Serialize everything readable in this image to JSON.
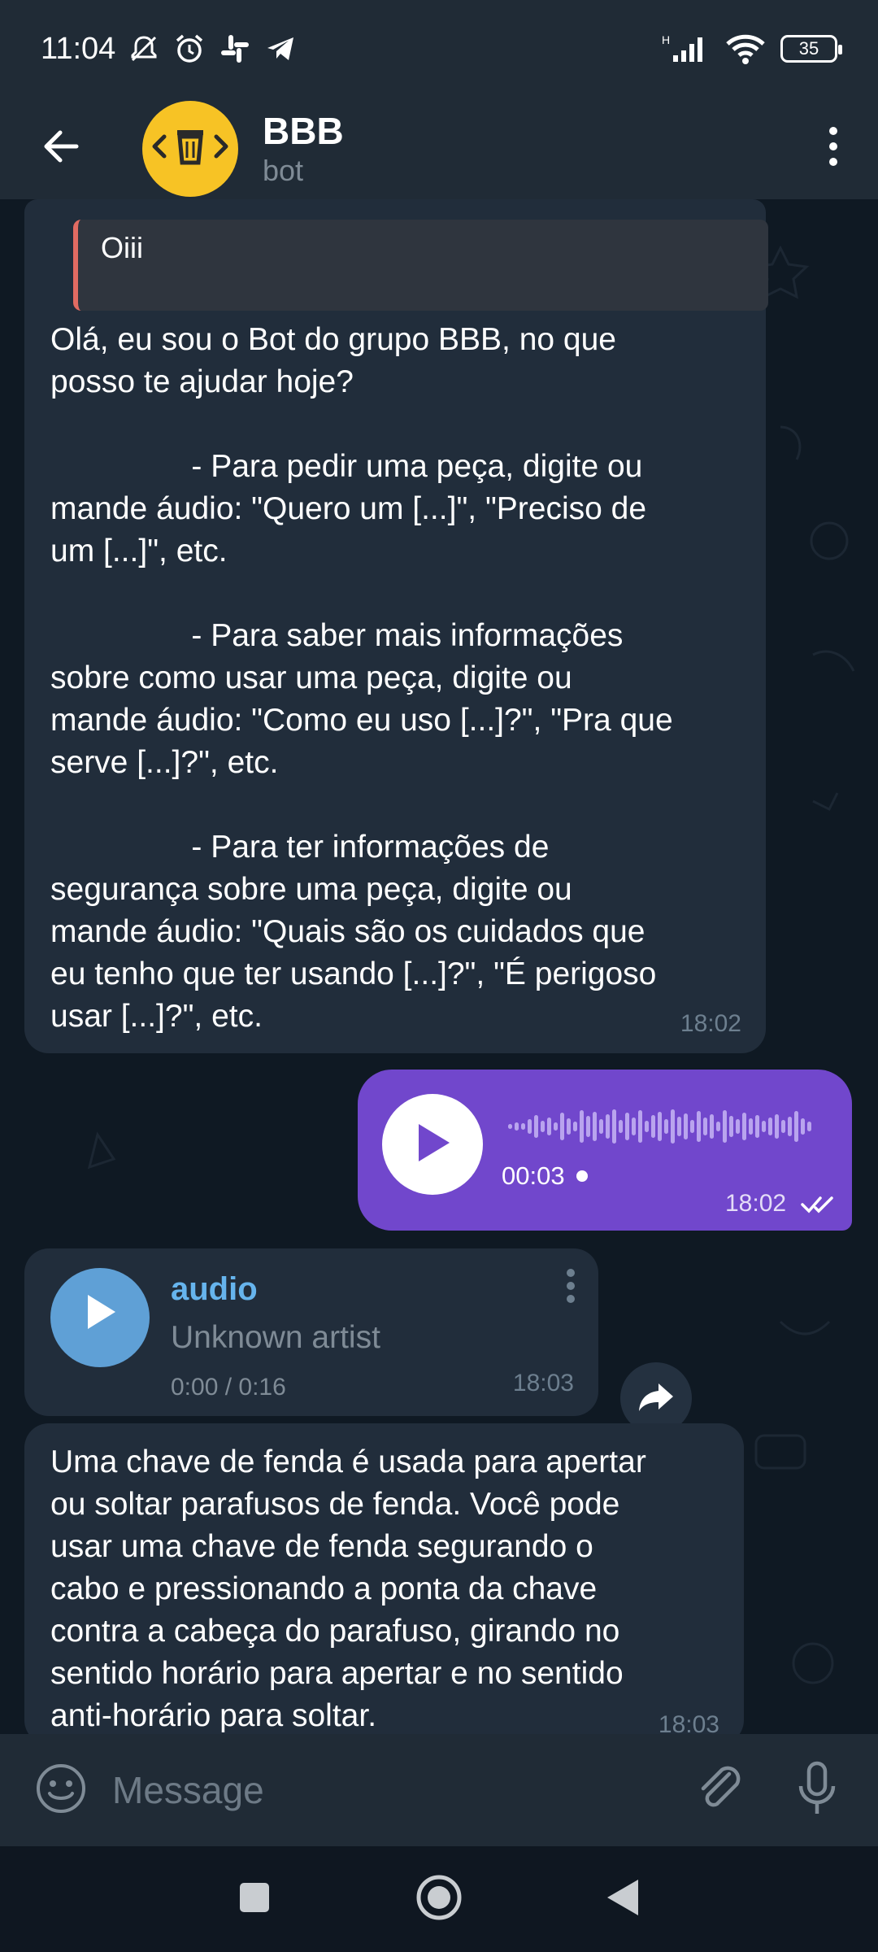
{
  "status_bar": {
    "time": "11:04",
    "battery": "35",
    "network": "H"
  },
  "header": {
    "title": "BBB",
    "subtitle": "bot"
  },
  "messages": {
    "bot_intro": {
      "reply_author": "",
      "reply_text": "Oiii",
      "text": "Olá, eu sou o Bot do grupo BBB, no que\nposso te ajudar hoje?\n\n                - Para pedir uma peça, digite ou\nmande áudio: \"Quero um [...]\", \"Preciso de\num [...]\", etc.\n\n                - Para saber mais informações\nsobre como usar uma peça, digite ou\nmande áudio: \"Como eu uso [...]?\", \"Pra que\nserve [...]?\", etc.\n\n                - Para ter informações de\nsegurança sobre uma peça, digite ou\nmande áudio: \"Quais são os cuidados que\neu tenho que ter usando [...]?\", \"É perigoso\nusar [...]?\", etc.",
      "time": "18:02"
    },
    "voice_out": {
      "duration": "00:03",
      "time": "18:02"
    },
    "audio_in": {
      "title": "audio",
      "artist": "Unknown artist",
      "progress": "0:00 / 0:16",
      "time": "18:03"
    },
    "bot_answer": {
      "text": "Uma chave de fenda é usada para apertar\nou soltar parafusos de fenda. Você pode\nusar uma chave de fenda segurando o\ncabo e pressionando a ponta da chave\ncontra a cabeça do parafuso, girando no\nsentido horário para apertar e no sentido\nanti-horário para soltar.",
      "time": "18:03"
    }
  },
  "input": {
    "placeholder": "Message"
  },
  "colors": {
    "header_bg": "#202b36",
    "chat_bg": "#0f1923",
    "incoming_bubble": "#212d3b",
    "outgoing_bubble": "#7147cc",
    "avatar_bg": "#f7c325",
    "accent_blue": "#66b4ed",
    "play_blue": "#5fa0d6"
  },
  "icons": [
    "muted-icon",
    "alarm-icon",
    "slack-icon",
    "telegram-icon",
    "signal-icon",
    "wifi-icon",
    "battery-icon",
    "back-arrow-icon",
    "bot-logo-icon",
    "more-vert-icon",
    "play-icon",
    "double-check-icon",
    "share-icon",
    "emoji-icon",
    "attach-icon",
    "mic-icon",
    "nav-recents-icon",
    "nav-home-icon",
    "nav-back-icon"
  ]
}
